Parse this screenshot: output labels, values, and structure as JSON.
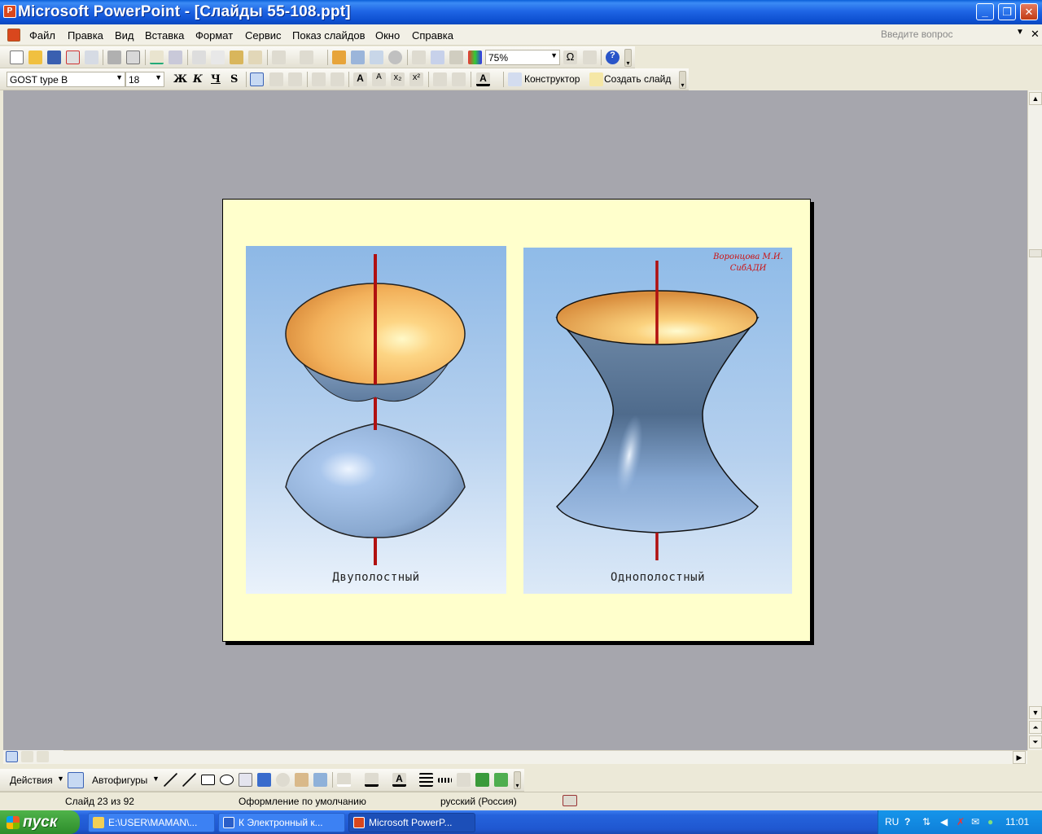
{
  "window": {
    "title": "Microsoft PowerPoint - [Слайды 55-108.ppt]",
    "buttons": {
      "minimize": "_",
      "restore": "❐",
      "close": "✕"
    }
  },
  "menu": {
    "items": [
      "Файл",
      "Правка",
      "Вид",
      "Вставка",
      "Формат",
      "Сервис",
      "Показ слайдов",
      "Окно",
      "Справка"
    ],
    "ask_placeholder": "Введите вопрос",
    "close_symbol": "✕"
  },
  "toolbar_standard": {
    "zoom": "75%"
  },
  "toolbar_formatting": {
    "font": "GOST type B",
    "size": "18",
    "bold": "Ж",
    "italic": "К",
    "underline": "Ч",
    "shadow": "S",
    "designer": "Конструктор",
    "new_slide": "Создать слайд"
  },
  "slide": {
    "left_caption": "Двуполостный",
    "right_caption": "Однополостный",
    "author_line1": "Воронцова М.И.",
    "author_line2": "СибАДИ"
  },
  "drawing_toolbar": {
    "actions": "Действия",
    "autoshapes": "Автофигуры"
  },
  "status": {
    "slide_info": "Слайд 23 из 92",
    "design": "Оформление по умолчанию",
    "language": "русский (Россия)"
  },
  "taskbar": {
    "start": "пуск",
    "tasks": [
      "E:\\USER\\MAMAN\\...",
      "К Электронный к...",
      "Microsoft PowerP..."
    ],
    "lang": "RU",
    "clock": "11:01"
  },
  "colors": {
    "titlebar": "#0d4fd0",
    "slide_background": "#ffffcc",
    "axis": "#b01010",
    "surface_inner": "#f3b461",
    "surface_outer": "#8fb2db"
  }
}
